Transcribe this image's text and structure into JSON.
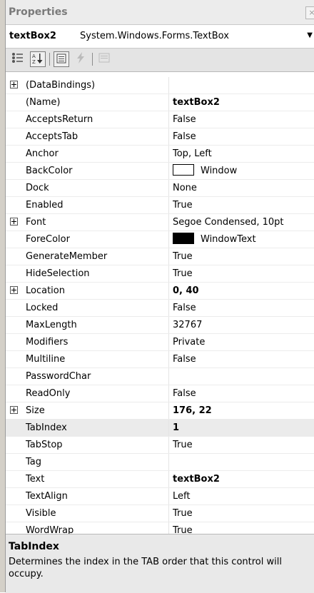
{
  "window": {
    "title": "Properties",
    "close_glyph": "×"
  },
  "object_selector": {
    "name": "textBox2",
    "type": "System.Windows.Forms.TextBox",
    "arrow_glyph": "▼"
  },
  "toolbar": {
    "categorized_icon": "categorized-icon",
    "alphabetical_icon": "alphabetical-icon",
    "properties_icon": "properties-icon",
    "events_icon": "events-icon",
    "property_pages_icon": "property-pages-icon"
  },
  "colors": {
    "window_swatch": "#ffffff",
    "windowtext_swatch": "#000000"
  },
  "properties": [
    {
      "name": "(DataBindings)",
      "value": "",
      "expandable": true,
      "bold": false
    },
    {
      "name": "(Name)",
      "value": "textBox2",
      "expandable": false,
      "bold": true
    },
    {
      "name": "AcceptsReturn",
      "value": "False",
      "expandable": false,
      "bold": false
    },
    {
      "name": "AcceptsTab",
      "value": "False",
      "expandable": false,
      "bold": false
    },
    {
      "name": "Anchor",
      "value": "Top, Left",
      "expandable": false,
      "bold": false
    },
    {
      "name": "BackColor",
      "value": "Window",
      "expandable": false,
      "bold": false,
      "swatch": "#ffffff"
    },
    {
      "name": "Dock",
      "value": "None",
      "expandable": false,
      "bold": false
    },
    {
      "name": "Enabled",
      "value": "True",
      "expandable": false,
      "bold": false
    },
    {
      "name": "Font",
      "value": "Segoe Condensed, 10pt",
      "expandable": true,
      "bold": false
    },
    {
      "name": "ForeColor",
      "value": "WindowText",
      "expandable": false,
      "bold": false,
      "swatch": "#000000"
    },
    {
      "name": "GenerateMember",
      "value": "True",
      "expandable": false,
      "bold": false
    },
    {
      "name": "HideSelection",
      "value": "True",
      "expandable": false,
      "bold": false
    },
    {
      "name": "Location",
      "value": "0, 40",
      "expandable": true,
      "bold": true
    },
    {
      "name": "Locked",
      "value": "False",
      "expandable": false,
      "bold": false
    },
    {
      "name": "MaxLength",
      "value": "32767",
      "expandable": false,
      "bold": false
    },
    {
      "name": "Modifiers",
      "value": "Private",
      "expandable": false,
      "bold": false
    },
    {
      "name": "Multiline",
      "value": "False",
      "expandable": false,
      "bold": false
    },
    {
      "name": "PasswordChar",
      "value": "",
      "expandable": false,
      "bold": false
    },
    {
      "name": "ReadOnly",
      "value": "False",
      "expandable": false,
      "bold": false
    },
    {
      "name": "Size",
      "value": "176, 22",
      "expandable": true,
      "bold": true
    },
    {
      "name": "TabIndex",
      "value": "1",
      "expandable": false,
      "bold": true,
      "selected": true
    },
    {
      "name": "TabStop",
      "value": "True",
      "expandable": false,
      "bold": false
    },
    {
      "name": "Tag",
      "value": "",
      "expandable": false,
      "bold": false
    },
    {
      "name": "Text",
      "value": "textBox2",
      "expandable": false,
      "bold": true
    },
    {
      "name": "TextAlign",
      "value": "Left",
      "expandable": false,
      "bold": false
    },
    {
      "name": "Visible",
      "value": "True",
      "expandable": false,
      "bold": false
    },
    {
      "name": "WordWrap",
      "value": "True",
      "expandable": false,
      "bold": false
    }
  ],
  "description": {
    "title": "TabIndex",
    "text": "Determines the index in the TAB order that this control will occupy."
  }
}
